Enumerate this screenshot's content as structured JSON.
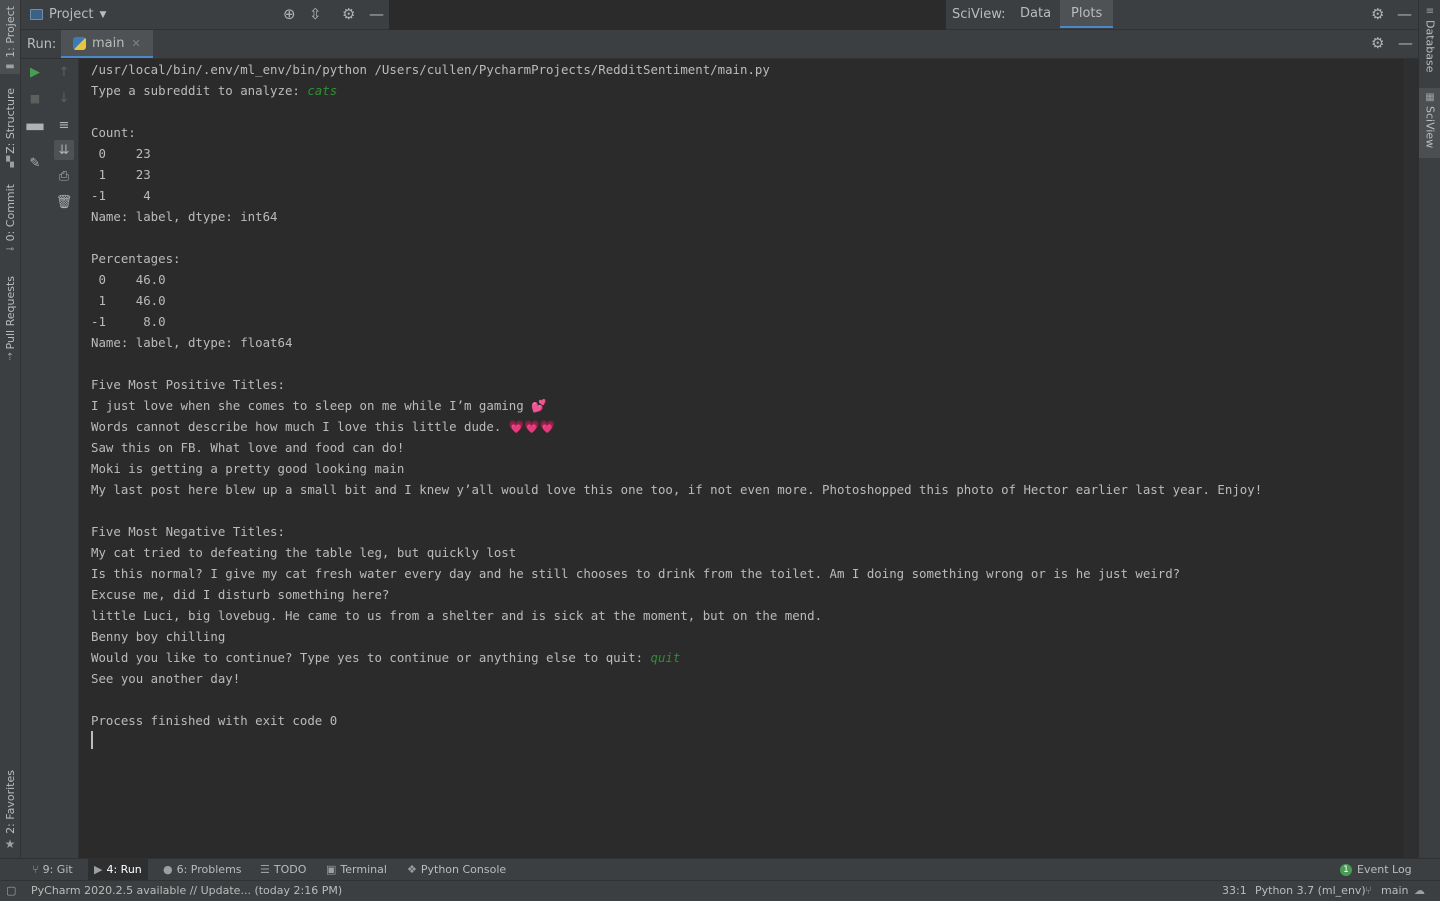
{
  "left_strip": {
    "project": "1: Project",
    "structure": "Z: Structure",
    "commit": "0: Commit",
    "pull_requests": "Pull Requests",
    "favorites": "2: Favorites"
  },
  "right_strip": {
    "database": "Database",
    "sciview": "SciView"
  },
  "project_bar": {
    "title": "Project"
  },
  "sciview": {
    "label": "SciView:",
    "tabs": [
      "Data",
      "Plots"
    ],
    "active_tab": "Plots"
  },
  "run": {
    "label": "Run:",
    "tab": "main"
  },
  "console": {
    "lines": [
      "/usr/local/bin/.env/ml_env/bin/python /Users/cullen/PycharmProjects/RedditSentiment/main.py",
      "Type a subreddit to analyze: ",
      "",
      "Count:",
      " 0    23",
      " 1    23",
      "-1     4",
      "Name: label, dtype: int64",
      "",
      "Percentages:",
      " 0    46.0",
      " 1    46.0",
      "-1     8.0",
      "Name: label, dtype: float64",
      "",
      "Five Most Positive Titles:",
      "I just love when she comes to sleep on me while I’m gaming ",
      "Words cannot describe how much I love this little dude. ",
      "Saw this on FB. What love and food can do!",
      "Moki is getting a pretty good looking main",
      "My last post here blew up a small bit and I knew y’all would love this one too, if not even more. Photoshopped this photo of Hector earlier last year. Enjoy!",
      "",
      "Five Most Negative Titles:",
      "My cat tried to defeating the table leg, but quickly lost",
      "Is this normal? I give my cat fresh water every day and he still chooses to drink from the toilet. Am I doing something wrong or is he just weird?",
      "Excuse me, did I disturb something here?",
      "little Luci, big lovebug. He came to us from a shelter and is sick at the moment, but on the mend.",
      "Benny boy chilling",
      "Would you like to continue? Type yes to continue or anything else to quit: ",
      "See you another day!",
      "",
      "Process finished with exit code 0"
    ],
    "input_subreddit": "cats",
    "input_quit": "quit",
    "emoji_line16": "💕",
    "emoji_line17": "💗💗💗"
  },
  "bottom_tabs": {
    "git": "9: Git",
    "run": "4: Run",
    "problems": "6: Problems",
    "todo": "TODO",
    "terminal": "Terminal",
    "python_console": "Python Console",
    "event_log": "Event Log",
    "event_count": "1"
  },
  "status": {
    "message": "PyCharm 2020.2.5 available // Update... (today 2:16 PM)",
    "position": "33:1",
    "interpreter": "Python 3.7 (ml_env)",
    "branch": "main"
  },
  "colors": {
    "background": "#2b2b2b",
    "panel": "#3c3f41",
    "accent": "#4a88c7",
    "input_green": "#318e32",
    "run_green": "#499c54"
  }
}
